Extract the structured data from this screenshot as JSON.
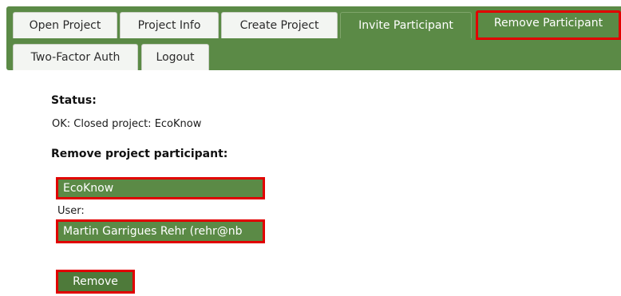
{
  "nav": {
    "tabs": [
      {
        "label": "Open Project"
      },
      {
        "label": "Project Info"
      },
      {
        "label": "Create Project"
      },
      {
        "label": "Invite Participant"
      },
      {
        "label": "Remove Participant"
      },
      {
        "label": "Two-Factor Auth"
      },
      {
        "label": "Logout"
      }
    ],
    "active_tab": "Remove Participant"
  },
  "status": {
    "heading": "Status:",
    "message": "OK: Closed project: EcoKnow"
  },
  "form": {
    "heading": "Remove project participant:",
    "project_value": "EcoKnow",
    "user_label": "User:",
    "user_value": "Martin Garrigues Rehr (rehr@nb",
    "submit_label": "Remove"
  },
  "colors": {
    "nav_green": "#5b8a46",
    "highlight_red": "#e10000"
  }
}
